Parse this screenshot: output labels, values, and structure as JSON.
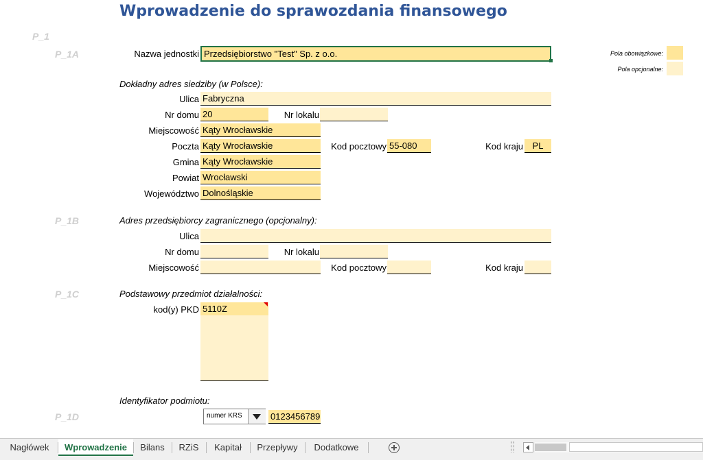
{
  "title": "Wprowadzenie do sprawozdania finansowego",
  "sections": {
    "p1": "P_1",
    "p1a": "P_1A",
    "p1b": "P_1B",
    "p1c": "P_1C",
    "p1d": "P_1D"
  },
  "legend": {
    "required": "Pola obowiązkowe:",
    "optional": "Pola opcjonalne:"
  },
  "colors": {
    "required": "#ffe699",
    "optional": "#fff2cc",
    "title": "#2f5597",
    "accent": "#217346"
  },
  "entity": {
    "label": "Nazwa jednostki",
    "value": "Przedsiębiorstwo \"Test\" Sp. z o.o."
  },
  "address": {
    "header": "Dokładny adres siedziby (w Polsce):",
    "street_label": "Ulica",
    "street": "Fabryczna",
    "house_label": "Nr domu",
    "house": "20",
    "flat_label": "Nr lokalu",
    "flat": "",
    "city_label": "Miejscowość",
    "city": "Kąty Wrocławskie",
    "post_label": "Poczta",
    "post": "Kąty Wrocławskie",
    "zip_label": "Kod pocztowy",
    "zip": "55-080",
    "country_label": "Kod kraju",
    "country": "PL",
    "commune_label": "Gmina",
    "commune": "Kąty Wrocławskie",
    "county_label": "Powiat",
    "county": "Wrocławski",
    "province_label": "Województwo",
    "province": "Dolnośląskie"
  },
  "foreign": {
    "header": "Adres przedsiębiorcy zagranicznego (opcjonalny):",
    "street_label": "Ulica",
    "street": "",
    "house_label": "Nr domu",
    "house": "",
    "flat_label": "Nr lokalu",
    "flat": "",
    "city_label": "Miejscowość",
    "city": "",
    "zip_label": "Kod pocztowy",
    "zip": "",
    "country_label": "Kod kraju",
    "country": ""
  },
  "activity": {
    "header": "Podstawowy przedmiot działalności:",
    "pkd_label": "kod(y) PKD",
    "pkd": [
      "5110Z",
      "",
      "",
      "",
      "",
      ""
    ]
  },
  "identifier": {
    "header": "Identyfikator podmiotu:",
    "type": "numer KRS",
    "value": "0123456789"
  },
  "tabs": [
    "Nagłówek",
    "Wprowadzenie",
    "Bilans",
    "RZiS",
    "Kapitał",
    "Przepływy",
    "Dodatkowe"
  ],
  "active_tab": "Wprowadzenie",
  "icons": {
    "add_sheet": "plus-circle-icon",
    "scroll_left": "triangle-left-icon",
    "dropdown": "triangle-down-icon"
  }
}
